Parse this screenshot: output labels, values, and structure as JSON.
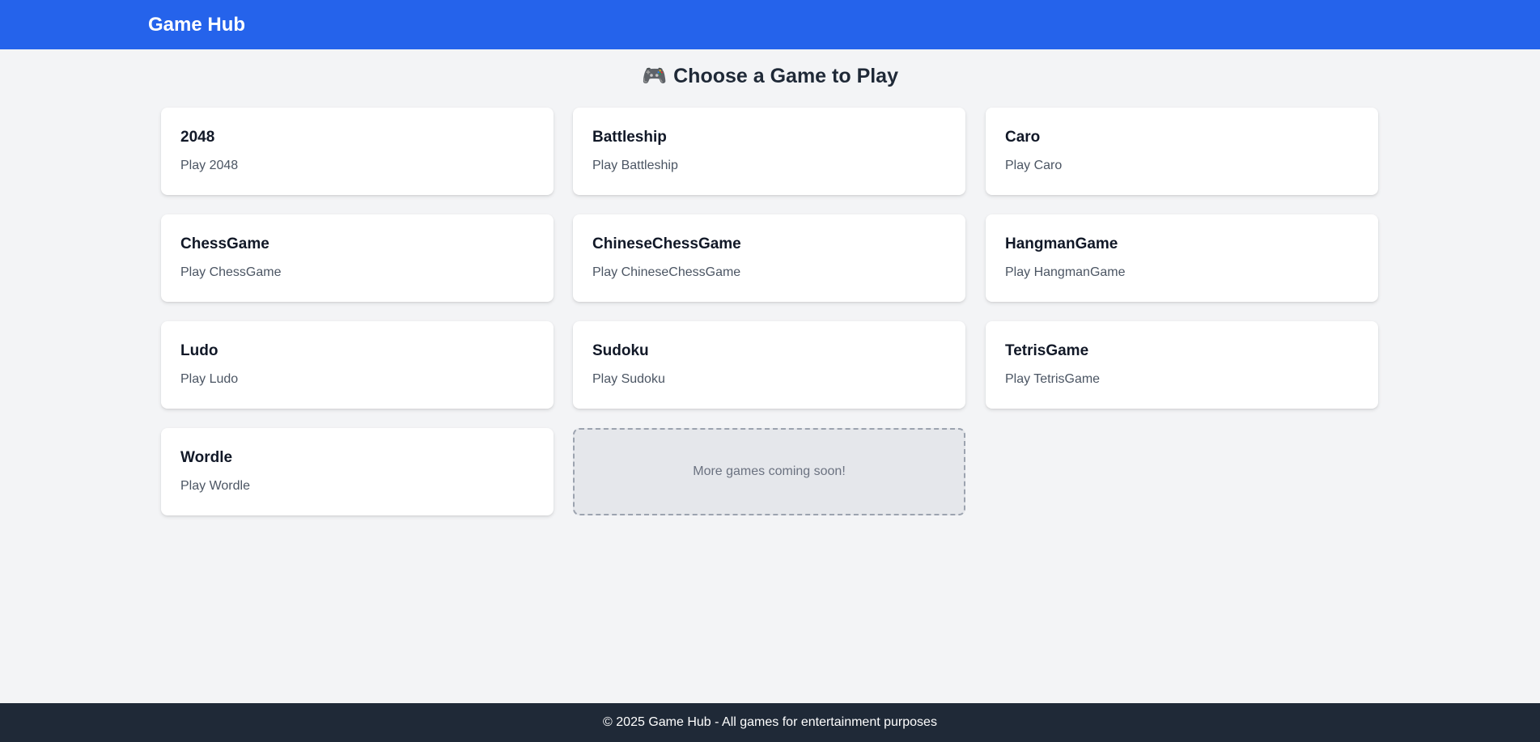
{
  "header": {
    "brand": "Game Hub"
  },
  "main": {
    "title_icon": "🎮",
    "title": "Choose a Game to Play",
    "games": [
      {
        "title": "2048",
        "subtitle": "Play 2048"
      },
      {
        "title": "Battleship",
        "subtitle": "Play Battleship"
      },
      {
        "title": "Caro",
        "subtitle": "Play Caro"
      },
      {
        "title": "ChessGame",
        "subtitle": "Play ChessGame"
      },
      {
        "title": "ChineseChessGame",
        "subtitle": "Play ChineseChessGame"
      },
      {
        "title": "HangmanGame",
        "subtitle": "Play HangmanGame"
      },
      {
        "title": "Ludo",
        "subtitle": "Play Ludo"
      },
      {
        "title": "Sudoku",
        "subtitle": "Play Sudoku"
      },
      {
        "title": "TetrisGame",
        "subtitle": "Play TetrisGame"
      },
      {
        "title": "Wordle",
        "subtitle": "Play Wordle"
      }
    ],
    "coming_soon": "More games coming soon!"
  },
  "footer": {
    "text": "© 2025 Game Hub - All games for entertainment purposes"
  },
  "colors": {
    "header": "#2563eb",
    "footer": "#1f2937",
    "background": "#f3f4f6"
  }
}
